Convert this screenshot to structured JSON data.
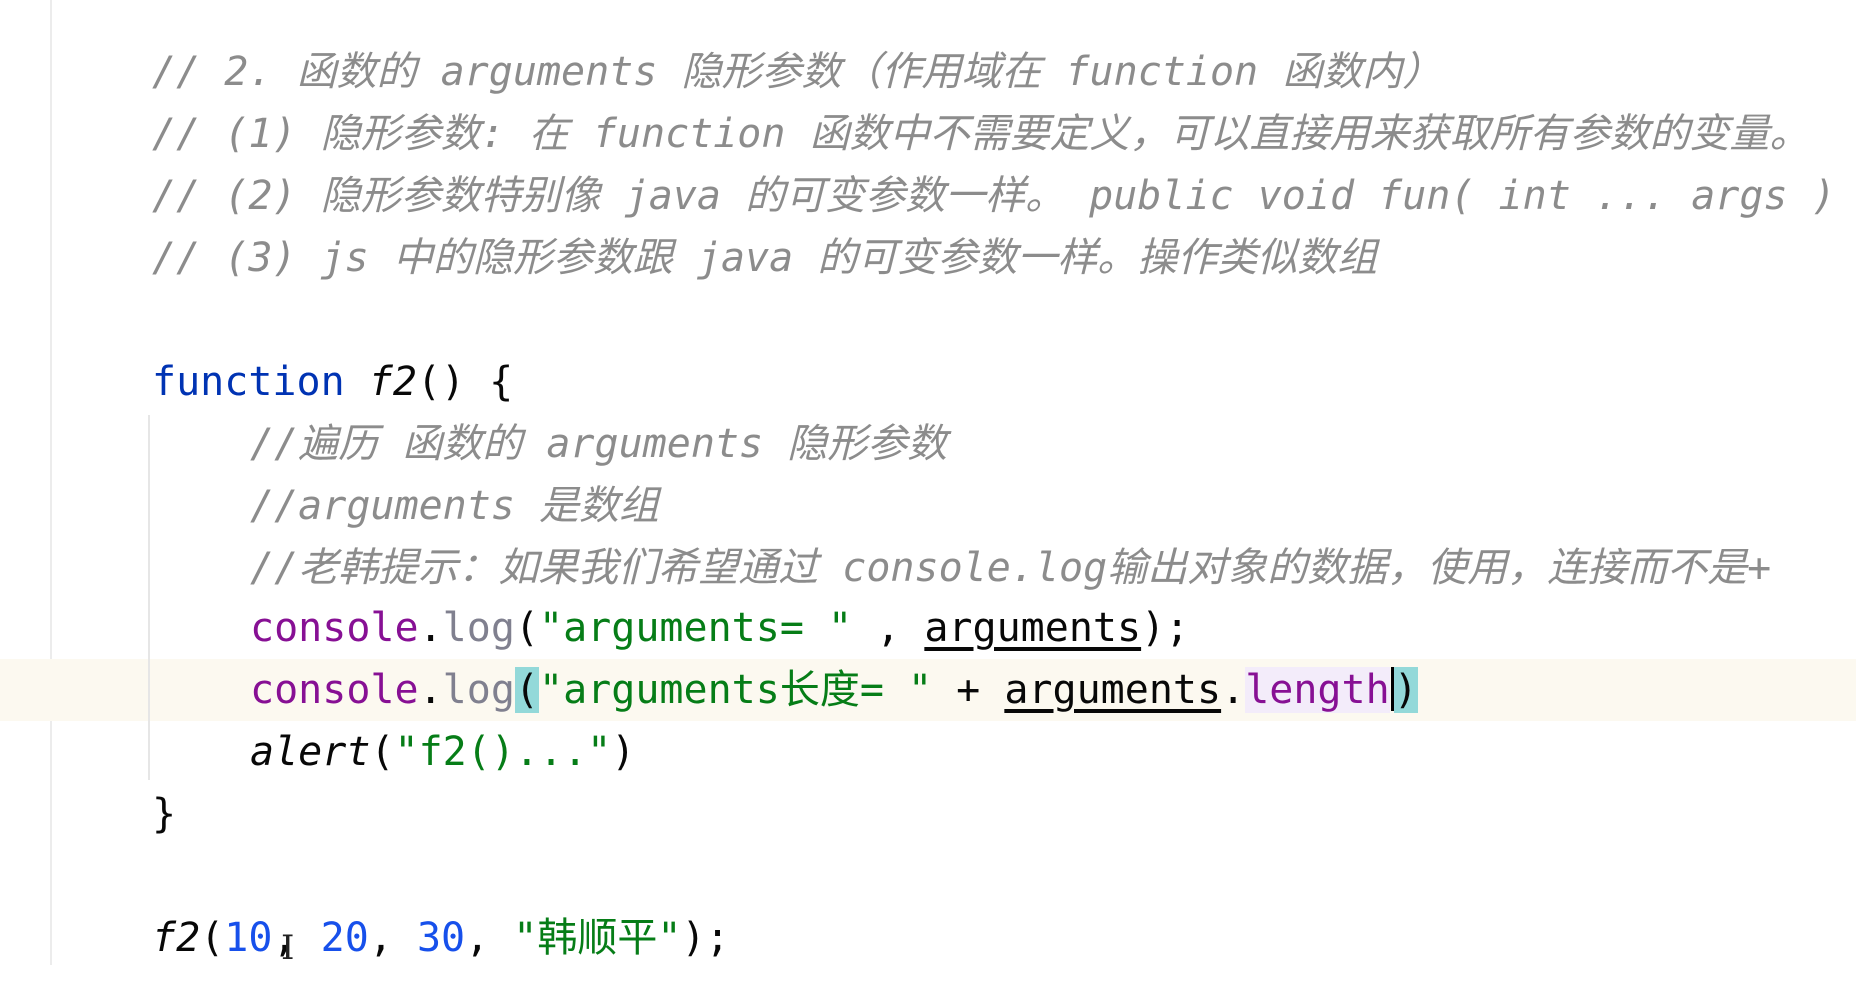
{
  "editor": {
    "comments": {
      "c1": "// 2. 函数的 arguments 隐形参数（作用域在 function 函数内）",
      "c2": "// (1) 隐形参数: 在 function 函数中不需要定义，可以直接用来获取所有参数的变量。",
      "c3": "// (2) 隐形参数特别像 java 的可变参数一样。 public void fun( int ... args )",
      "c4": "// (3) js 中的隐形参数跟 java 的可变参数一样。操作类似数组"
    },
    "func": {
      "keyword": "function",
      "name": "f2",
      "signature_rest": "() {",
      "comment1": "//遍历 函数的 arguments 隐形参数",
      "comment2": "//arguments 是数组",
      "comment3": "//老韩提示：如果我们希望通过 console.log输出对象的数据，使用，连接而不是+",
      "close": "}"
    },
    "stmt1": {
      "obj": "console",
      "dot": ".",
      "method": "log",
      "open": "(",
      "str": "\"arguments= \"",
      "sep": " , ",
      "arg": "arguments",
      "end": ");"
    },
    "stmt2": {
      "obj": "console",
      "dot": ".",
      "method": "log",
      "open": "(",
      "str": "\"arguments长度= \"",
      "plus": " + ",
      "arg": "arguments",
      "dot2": ".",
      "prop": "length",
      "close": ")"
    },
    "stmt3": {
      "fn": "alert",
      "open": "(",
      "str": "\"f2()...\"",
      "close": ")"
    },
    "call": {
      "fn": "f2",
      "open": "(",
      "n1": "10",
      "c1": ", ",
      "n2": "20",
      "c2": ", ",
      "n3": "30",
      "c3": ", ",
      "str": "\"韩顺平\"",
      "end": ");"
    }
  }
}
